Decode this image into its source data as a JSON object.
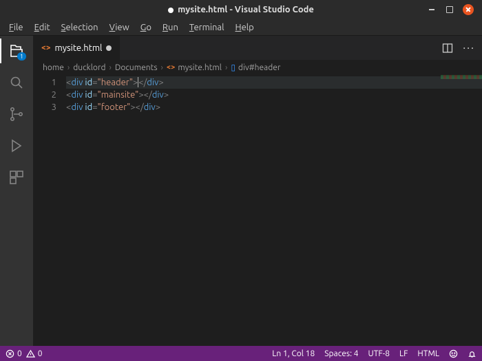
{
  "title": "mysite.html - Visual Studio Code",
  "menu": [
    "File",
    "Edit",
    "Selection",
    "View",
    "Go",
    "Run",
    "Terminal",
    "Help"
  ],
  "activity_badge": "1",
  "tab": {
    "filename": "mysite.html"
  },
  "breadcrumb": {
    "p1": "home",
    "p2": "ducklord",
    "p3": "Documents",
    "p4": "mysite.html",
    "p5": "div#header"
  },
  "code": {
    "lineno": [
      "1",
      "2",
      "3"
    ],
    "l1": {
      "open_lt": "<",
      "tag": "div",
      "attr": "id",
      "eq": "=",
      "val": "\"header\"",
      "close_gt": ">",
      "open_lt2": "</",
      "tag2": "div",
      "close_gt2": ">"
    },
    "l2": {
      "open_lt": "<",
      "tag": "div",
      "attr": "id",
      "eq": "=",
      "val": "\"mainsite\"",
      "close_gt": ">",
      "open_lt2": "</",
      "tag2": "div",
      "close_gt2": ">"
    },
    "l3": {
      "open_lt": "<",
      "tag": "div",
      "attr": "id",
      "eq": "=",
      "val": "\"footer\"",
      "close_gt": ">",
      "open_lt2": "</",
      "tag2": "div",
      "close_gt2": ">"
    }
  },
  "status": {
    "errors": "0",
    "warnings": "0",
    "ln_col": "Ln 1, Col 18",
    "spaces": "Spaces: 4",
    "encoding": "UTF-8",
    "eol": "LF",
    "lang": "HTML"
  }
}
